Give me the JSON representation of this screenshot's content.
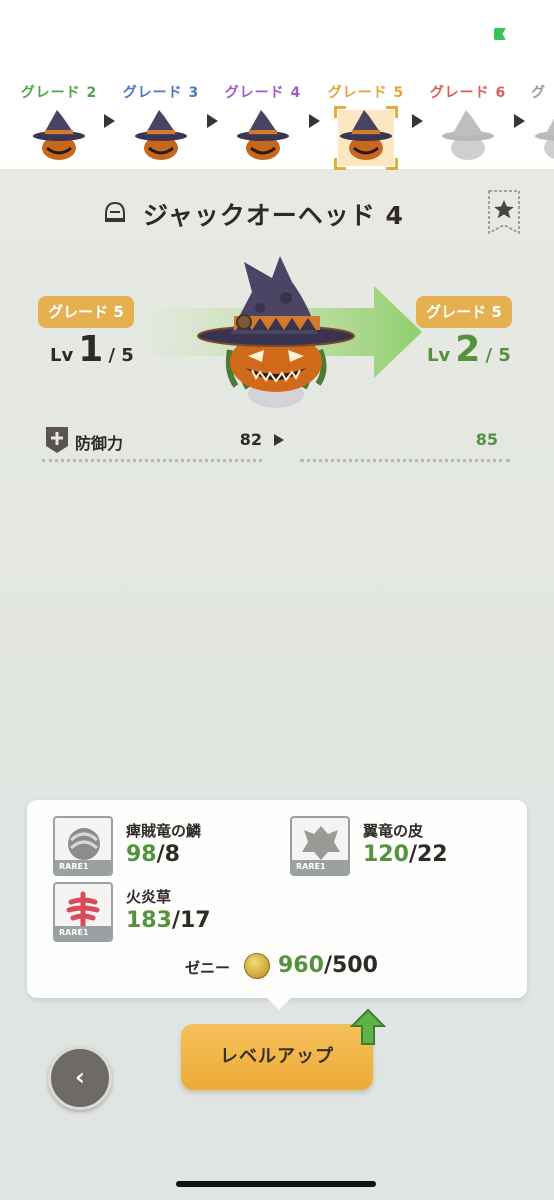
{
  "grades": [
    {
      "label": "グレード 2",
      "color": "#4ea54a",
      "state": "unlocked"
    },
    {
      "label": "グレード 3",
      "color": "#4a78c4",
      "state": "unlocked"
    },
    {
      "label": "グレード 4",
      "color": "#a25bc8",
      "state": "unlocked"
    },
    {
      "label": "グレード 5",
      "color": "#e3a43b",
      "state": "selected"
    },
    {
      "label": "グレード 6",
      "color": "#d95b5b",
      "state": "locked"
    },
    {
      "label": "グ",
      "color": "#9c9c9c",
      "state": "locked"
    }
  ],
  "item": {
    "title": "ジャックオーヘッド 4",
    "icon": "helmet-icon"
  },
  "upgrade": {
    "current": {
      "grade": "グレード 5",
      "lv_prefix": "Lv",
      "lv": "1",
      "lv_max": "/ 5"
    },
    "next": {
      "grade": "グレード 5",
      "lv_prefix": "Lv",
      "lv": "2",
      "lv_max": "/ 5"
    }
  },
  "stat": {
    "icon": "shield-plus-icon",
    "label": "防御力",
    "current": "82",
    "next": "85"
  },
  "materials": [
    {
      "name": "痺賊竜の鱗",
      "rarity": "RARE1",
      "have": "98",
      "need": "/8",
      "icon": "scale-icon"
    },
    {
      "name": "翼竜の皮",
      "rarity": "RARE1",
      "have": "120",
      "need": "/22",
      "icon": "hide-icon"
    },
    {
      "name": "火炎草",
      "rarity": "RARE1",
      "have": "183",
      "need": "/17",
      "icon": "fire-herb-icon"
    }
  ],
  "zeny": {
    "label": "ゼニー",
    "have": "960",
    "need": "/500"
  },
  "buttons": {
    "level_up": "レベルアップ",
    "back": "‹"
  },
  "colors": {
    "accent": "#e8ac3a",
    "success": "#55923e"
  }
}
